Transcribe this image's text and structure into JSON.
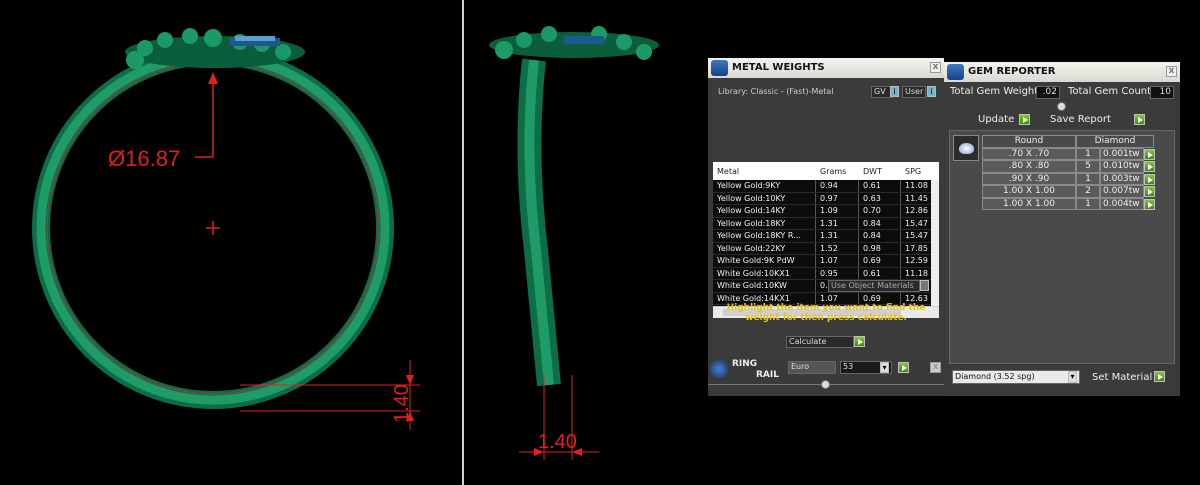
{
  "left_view": {
    "diameter_label": "Ø16.87",
    "thickness_label": "1.40"
  },
  "side_view": {
    "width_label": "1.40"
  },
  "metal_weights": {
    "title": "METAL WEIGHTS",
    "library": "Library: Classic - (Fast)-Metal",
    "gv_label": "GV",
    "user_label": "User",
    "info_glyph": "i",
    "close_glyph": "x",
    "columns": [
      "Metal",
      "Grams",
      "DWT",
      "SPG"
    ],
    "rows": [
      [
        "Yellow Gold:9KY",
        "0.94",
        "0.61",
        "11.08"
      ],
      [
        "Yellow Gold:10KY",
        "0.97",
        "0.63",
        "11.45"
      ],
      [
        "Yellow Gold:14KY",
        "1.09",
        "0.70",
        "12.86"
      ],
      [
        "Yellow Gold:18KY",
        "1.31",
        "0.84",
        "15.47"
      ],
      [
        "Yellow Gold:18KY R...",
        "1.31",
        "0.84",
        "15.47"
      ],
      [
        "Yellow Gold:22KY",
        "1.52",
        "0.98",
        "17.85"
      ],
      [
        "White Gold:9K PdW",
        "1.07",
        "0.69",
        "12.59"
      ],
      [
        "White Gold:10KX1",
        "0.95",
        "0.61",
        "11.18"
      ],
      [
        "White Gold:10KW",
        "0.93",
        "0.60",
        "10.95"
      ],
      [
        "White Gold:14KX1",
        "1.07",
        "0.69",
        "12.63"
      ],
      [
        "White Gold:14K PdW",
        "1.22",
        "0.78",
        "14.35"
      ]
    ],
    "use_object_materials": "Use Object Materials",
    "instruction": "Highlight the item you want to find the weight for then press calculate.",
    "calculate": "Calculate"
  },
  "ring_rail": {
    "title_line1": "RING",
    "title_line2": "RAIL",
    "standard": "Euro",
    "size": "53"
  },
  "gem_reporter": {
    "title": "GEM REPORTER",
    "total_weight_label": "Total Gem Weight",
    "total_weight_value": ".02",
    "total_count_label": "Total Gem Count",
    "total_count_value": "10",
    "update_label": "Update",
    "save_report_label": "Save Report",
    "columns": [
      "Round",
      "Diamond"
    ],
    "rows": [
      [
        ".70 X .70",
        "1",
        "0.001tw"
      ],
      [
        ".80 X .80",
        "5",
        "0.010tw"
      ],
      [
        ".90 X .90",
        "1",
        "0.003tw"
      ],
      [
        "1.00 X 1.00",
        "2",
        "0.007tw"
      ],
      [
        "1.00 X 1.00",
        "1",
        "0.004tw"
      ]
    ],
    "material_select": "Diamond     (3.52 spg)",
    "set_material_label": "Set Material"
  }
}
